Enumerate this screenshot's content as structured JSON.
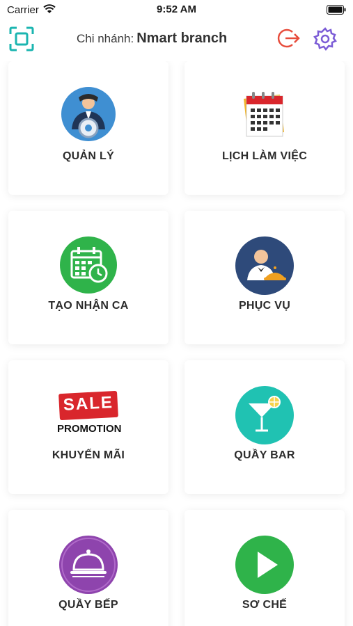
{
  "status_bar": {
    "carrier": "Carrier",
    "time": "9:52 AM"
  },
  "header": {
    "branch_label": "Chi nhánh:",
    "branch_name": "Nmart branch"
  },
  "menu": [
    {
      "label": "QUẢN LÝ",
      "icon": "manager-icon"
    },
    {
      "label": "LỊCH LÀM VIỆC",
      "icon": "calendar-icon"
    },
    {
      "label": "TẠO NHẬN CA",
      "icon": "shift-calendar-icon"
    },
    {
      "label": "PHỤC VỤ",
      "icon": "waiter-icon"
    },
    {
      "label": "KHUYẾN MÃI",
      "icon": "sale-promotion-icon",
      "badge_text": "SALE",
      "badge_subtext": "PROMOTION"
    },
    {
      "label": "QUẦY BAR",
      "icon": "cocktail-icon"
    },
    {
      "label": "QUẦY BẾP",
      "icon": "service-bell-icon"
    },
    {
      "label": "SƠ CHẾ",
      "icon": "play-icon"
    }
  ],
  "colors": {
    "scan_teal": "#1bb5b0",
    "logout_red": "#e74c3c",
    "settings_purple": "#7b5cd6",
    "manager_blue": "#3f8fd2",
    "green": "#2fb34a",
    "navy": "#2e4a7a",
    "teal": "#20c2b2",
    "purple": "#8e44ad",
    "sale_red": "#d9262c"
  }
}
